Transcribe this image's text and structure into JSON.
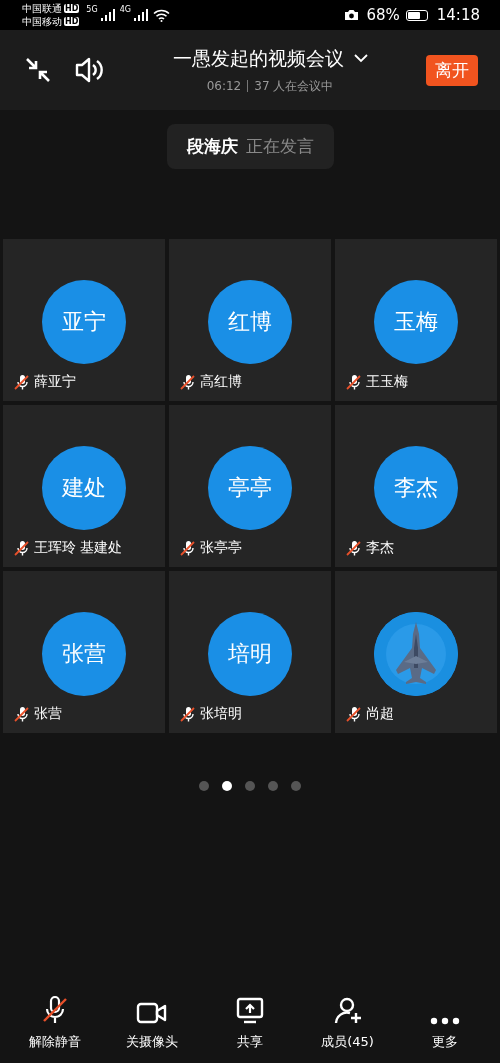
{
  "status_bar": {
    "carriers": [
      {
        "name": "中国联通",
        "badge": "HD"
      },
      {
        "name": "中国移动",
        "badge": "HD"
      }
    ],
    "networks": [
      "5G",
      "4G"
    ],
    "battery": "68%",
    "time": "14:18"
  },
  "header": {
    "title": "一愚发起的视频会议",
    "duration": "06:12",
    "participants": "37 人在会议中",
    "leave": "离开"
  },
  "speaker": {
    "name": "段海庆",
    "status": "正在发言"
  },
  "participants": [
    {
      "kind": "initials",
      "avatar": "亚宁",
      "name": "薛亚宁",
      "muted": true
    },
    {
      "kind": "initials",
      "avatar": "红博",
      "name": "高红博",
      "muted": true
    },
    {
      "kind": "initials",
      "avatar": "玉梅",
      "name": "王玉梅",
      "muted": true
    },
    {
      "kind": "initials",
      "avatar": "建处",
      "name": "王珲玲 基建处",
      "muted": true
    },
    {
      "kind": "initials",
      "avatar": "亭亭",
      "name": "张亭亭",
      "muted": true
    },
    {
      "kind": "initials",
      "avatar": "李杰",
      "name": "李杰",
      "muted": true
    },
    {
      "kind": "initials",
      "avatar": "张营",
      "name": "张营",
      "muted": true
    },
    {
      "kind": "initials",
      "avatar": "培明",
      "name": "张培明",
      "muted": true
    },
    {
      "kind": "picture",
      "name": "尚超",
      "muted": true
    }
  ],
  "pages": [
    {
      "selected": false
    },
    {
      "selected": true
    },
    {
      "selected": false
    },
    {
      "selected": false
    },
    {
      "selected": false
    }
  ],
  "toolbar": [
    {
      "kind": "mic",
      "label": "解除静音",
      "muted": true
    },
    {
      "kind": "camera",
      "label": "关摄像头"
    },
    {
      "kind": "share",
      "label": "共享"
    },
    {
      "kind": "members",
      "label": "成员(45)"
    },
    {
      "kind": "more",
      "label": "更多"
    }
  ]
}
